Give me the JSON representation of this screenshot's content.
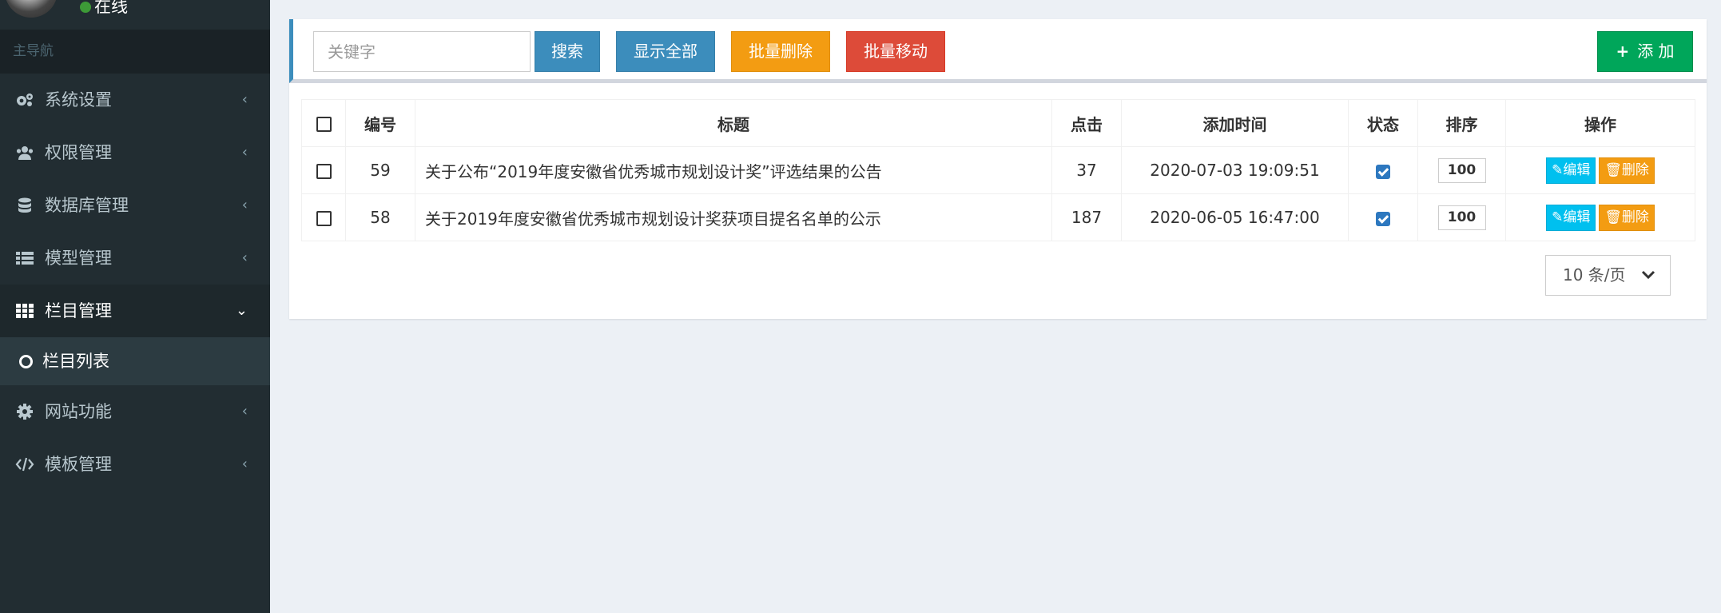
{
  "user": {
    "status": "在线"
  },
  "sidebar": {
    "header": "主导航",
    "items": [
      {
        "label": "系统设置",
        "icon": "gears-icon"
      },
      {
        "label": "权限管理",
        "icon": "users-icon"
      },
      {
        "label": "数据库管理",
        "icon": "database-icon"
      },
      {
        "label": "模型管理",
        "icon": "table-icon"
      },
      {
        "label": "栏目管理",
        "icon": "grid-icon",
        "active": true
      },
      {
        "label": "网站功能",
        "icon": "gear-icon"
      },
      {
        "label": "模板管理",
        "icon": "code-icon"
      }
    ],
    "sub_item": {
      "label": "栏目列表"
    },
    "chevron_collapsed": "‹",
    "chevron_expanded": "⌄"
  },
  "toolbar": {
    "search_placeholder": "关键字",
    "search_label": "搜索",
    "show_all_label": "显示全部",
    "batch_delete_label": "批量删除",
    "batch_move_label": "批量移动",
    "add_label": "添 加",
    "add_icon": "+"
  },
  "table": {
    "headers": [
      "",
      "编号",
      "标题",
      "点击",
      "添加时间",
      "状态",
      "排序",
      "操作"
    ],
    "rows": [
      {
        "id": "59",
        "title": "关于公布“2019年度安徽省优秀城市规划设计奖”评选结果的公告",
        "clicks": "37",
        "time": "2020-07-03 19:09:51",
        "status": true,
        "sort": "100"
      },
      {
        "id": "58",
        "title": "关于2019年度安徽省优秀城市规划设计奖获项目提名名单的公示",
        "clicks": "187",
        "time": "2020-06-05 16:47:00",
        "status": true,
        "sort": "100"
      }
    ],
    "edit_label": "编辑",
    "delete_label": "删除"
  },
  "pager": {
    "per_page": "10 条/页"
  },
  "colors": {
    "sidebar_bg": "#222d32",
    "primary": "#3c8dbc",
    "success": "#00a65a",
    "warning": "#f39c12",
    "danger": "#dd4b39",
    "info": "#00c0ef"
  }
}
